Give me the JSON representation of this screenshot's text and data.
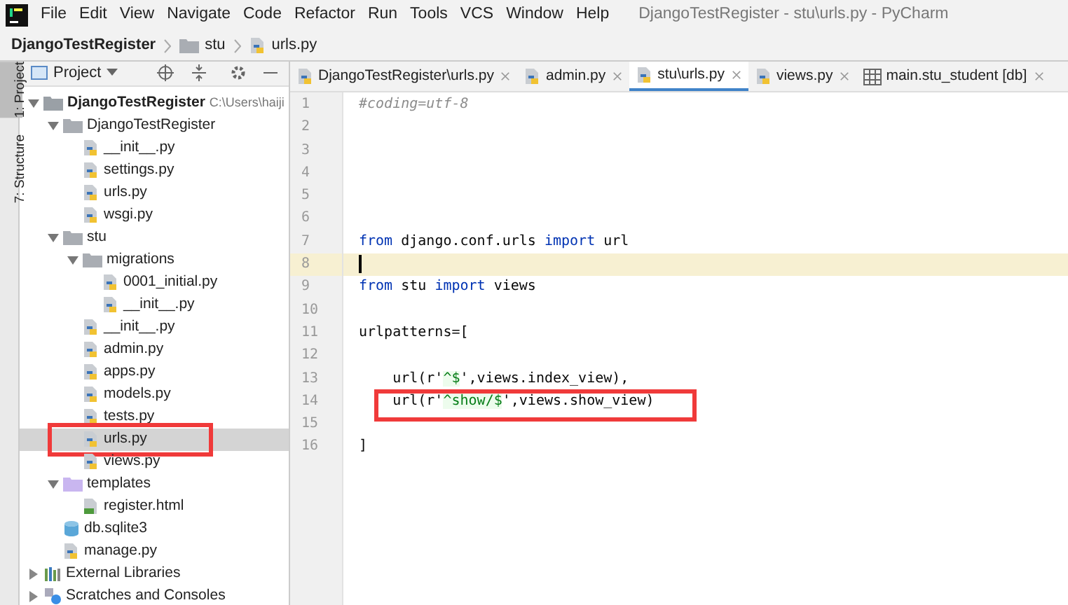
{
  "menu_bar": {
    "items": [
      "File",
      "Edit",
      "View",
      "Navigate",
      "Code",
      "Refactor",
      "Run",
      "Tools",
      "VCS",
      "Window",
      "Help"
    ],
    "title": "DjangoTestRegister - stu\\urls.py - PyCharm"
  },
  "breadcrumb": [
    {
      "label": "DjangoTestRegister",
      "kind": "project"
    },
    {
      "label": "stu",
      "kind": "folder"
    },
    {
      "label": "urls.py",
      "kind": "python"
    }
  ],
  "side_strip": [
    {
      "label": "1: Project",
      "selected": true
    },
    {
      "label": "7: Structure",
      "selected": false
    }
  ],
  "project_panel": {
    "title": "Project",
    "tree": [
      {
        "label": "DjangoTestRegister",
        "kind": "root",
        "path": "C:\\Users\\haiji",
        "expanded": true,
        "selected": false,
        "highlighted": false,
        "children": [
          {
            "label": "DjangoTestRegister",
            "kind": "folder",
            "expanded": true,
            "selected": false,
            "highlighted": false,
            "children": [
              {
                "label": "__init__.py",
                "kind": "python",
                "selected": false,
                "highlighted": false
              },
              {
                "label": "settings.py",
                "kind": "python",
                "selected": false,
                "highlighted": false
              },
              {
                "label": "urls.py",
                "kind": "python",
                "selected": false,
                "highlighted": false
              },
              {
                "label": "wsgi.py",
                "kind": "python",
                "selected": false,
                "highlighted": false
              }
            ]
          },
          {
            "label": "stu",
            "kind": "folder",
            "expanded": true,
            "selected": false,
            "highlighted": false,
            "children": [
              {
                "label": "migrations",
                "kind": "folder",
                "expanded": true,
                "selected": false,
                "highlighted": false,
                "children": [
                  {
                    "label": "0001_initial.py",
                    "kind": "python",
                    "selected": false,
                    "highlighted": false
                  },
                  {
                    "label": "__init__.py",
                    "kind": "python",
                    "selected": false,
                    "highlighted": false
                  }
                ]
              },
              {
                "label": "__init__.py",
                "kind": "python",
                "selected": false,
                "highlighted": false
              },
              {
                "label": "admin.py",
                "kind": "python",
                "selected": false,
                "highlighted": false
              },
              {
                "label": "apps.py",
                "kind": "python",
                "selected": false,
                "highlighted": false
              },
              {
                "label": "models.py",
                "kind": "python",
                "selected": false,
                "highlighted": false
              },
              {
                "label": "tests.py",
                "kind": "python",
                "selected": false,
                "highlighted": false
              },
              {
                "label": "urls.py",
                "kind": "python",
                "selected": true,
                "highlighted": true
              },
              {
                "label": "views.py",
                "kind": "python",
                "selected": false,
                "highlighted": false
              }
            ]
          },
          {
            "label": "templates",
            "kind": "templates",
            "expanded": true,
            "selected": false,
            "highlighted": false,
            "children": [
              {
                "label": "register.html",
                "kind": "html",
                "selected": false,
                "highlighted": false
              }
            ]
          },
          {
            "label": "db.sqlite3",
            "kind": "db",
            "selected": false,
            "highlighted": false
          },
          {
            "label": "manage.py",
            "kind": "python",
            "selected": false,
            "highlighted": false
          }
        ]
      },
      {
        "label": "External Libraries",
        "kind": "library",
        "expanded": false,
        "selected": false,
        "highlighted": false
      },
      {
        "label": "Scratches and Consoles",
        "kind": "scratches",
        "expanded": false,
        "selected": false,
        "highlighted": false
      }
    ]
  },
  "tabs": [
    {
      "label": "DjangoTestRegister\\urls.py",
      "kind": "python",
      "selected": false
    },
    {
      "label": "admin.py",
      "kind": "python",
      "selected": false
    },
    {
      "label": "stu\\urls.py",
      "kind": "python",
      "selected": true
    },
    {
      "label": "views.py",
      "kind": "python",
      "selected": false
    },
    {
      "label": "main.stu_student [db]",
      "kind": "table",
      "selected": false
    }
  ],
  "editor": {
    "lines": [
      {
        "number": "1",
        "current": false,
        "highlighted": false,
        "tokens": [
          {
            "text": "#coding=utf-8",
            "kind": "comment"
          }
        ]
      },
      {
        "number": "2",
        "current": false,
        "highlighted": false
      },
      {
        "number": "3",
        "current": false,
        "highlighted": false
      },
      {
        "number": "4",
        "current": false,
        "highlighted": false
      },
      {
        "number": "5",
        "current": false,
        "highlighted": false
      },
      {
        "number": "6",
        "current": false,
        "highlighted": false
      },
      {
        "number": "7",
        "current": false,
        "highlighted": false,
        "tokens": [
          {
            "text": "from",
            "kind": "keyword"
          },
          {
            "text": " django.conf.urls ",
            "kind": "plain"
          },
          {
            "text": "import",
            "kind": "keyword"
          },
          {
            "text": " url",
            "kind": "plain"
          }
        ]
      },
      {
        "number": "8",
        "current": true,
        "highlighted": false
      },
      {
        "number": "9",
        "current": false,
        "highlighted": false,
        "tokens": [
          {
            "text": "from",
            "kind": "keyword"
          },
          {
            "text": " stu ",
            "kind": "plain"
          },
          {
            "text": "import",
            "kind": "keyword"
          },
          {
            "text": " views",
            "kind": "plain"
          }
        ]
      },
      {
        "number": "10",
        "current": false,
        "highlighted": false
      },
      {
        "number": "11",
        "current": false,
        "highlighted": false,
        "tokens": [
          {
            "text": "urlpatterns=[",
            "kind": "plain"
          }
        ]
      },
      {
        "number": "12",
        "current": false,
        "highlighted": false
      },
      {
        "number": "13",
        "current": false,
        "highlighted": false,
        "tokens": [
          {
            "text": "    url(r'",
            "kind": "plain"
          },
          {
            "text": "^$",
            "kind": "string"
          },
          {
            "text": "',views.index_view),",
            "kind": "plain"
          }
        ]
      },
      {
        "number": "14",
        "current": false,
        "highlighted": true,
        "tokens": [
          {
            "text": "    url(r'",
            "kind": "plain"
          },
          {
            "text": "^show/$",
            "kind": "string"
          },
          {
            "text": "',views.show_view)",
            "kind": "plain"
          }
        ]
      },
      {
        "number": "15",
        "current": false,
        "highlighted": false
      },
      {
        "number": "16",
        "current": false,
        "highlighted": false,
        "tokens": [
          {
            "text": "]",
            "kind": "plain"
          }
        ]
      }
    ]
  }
}
